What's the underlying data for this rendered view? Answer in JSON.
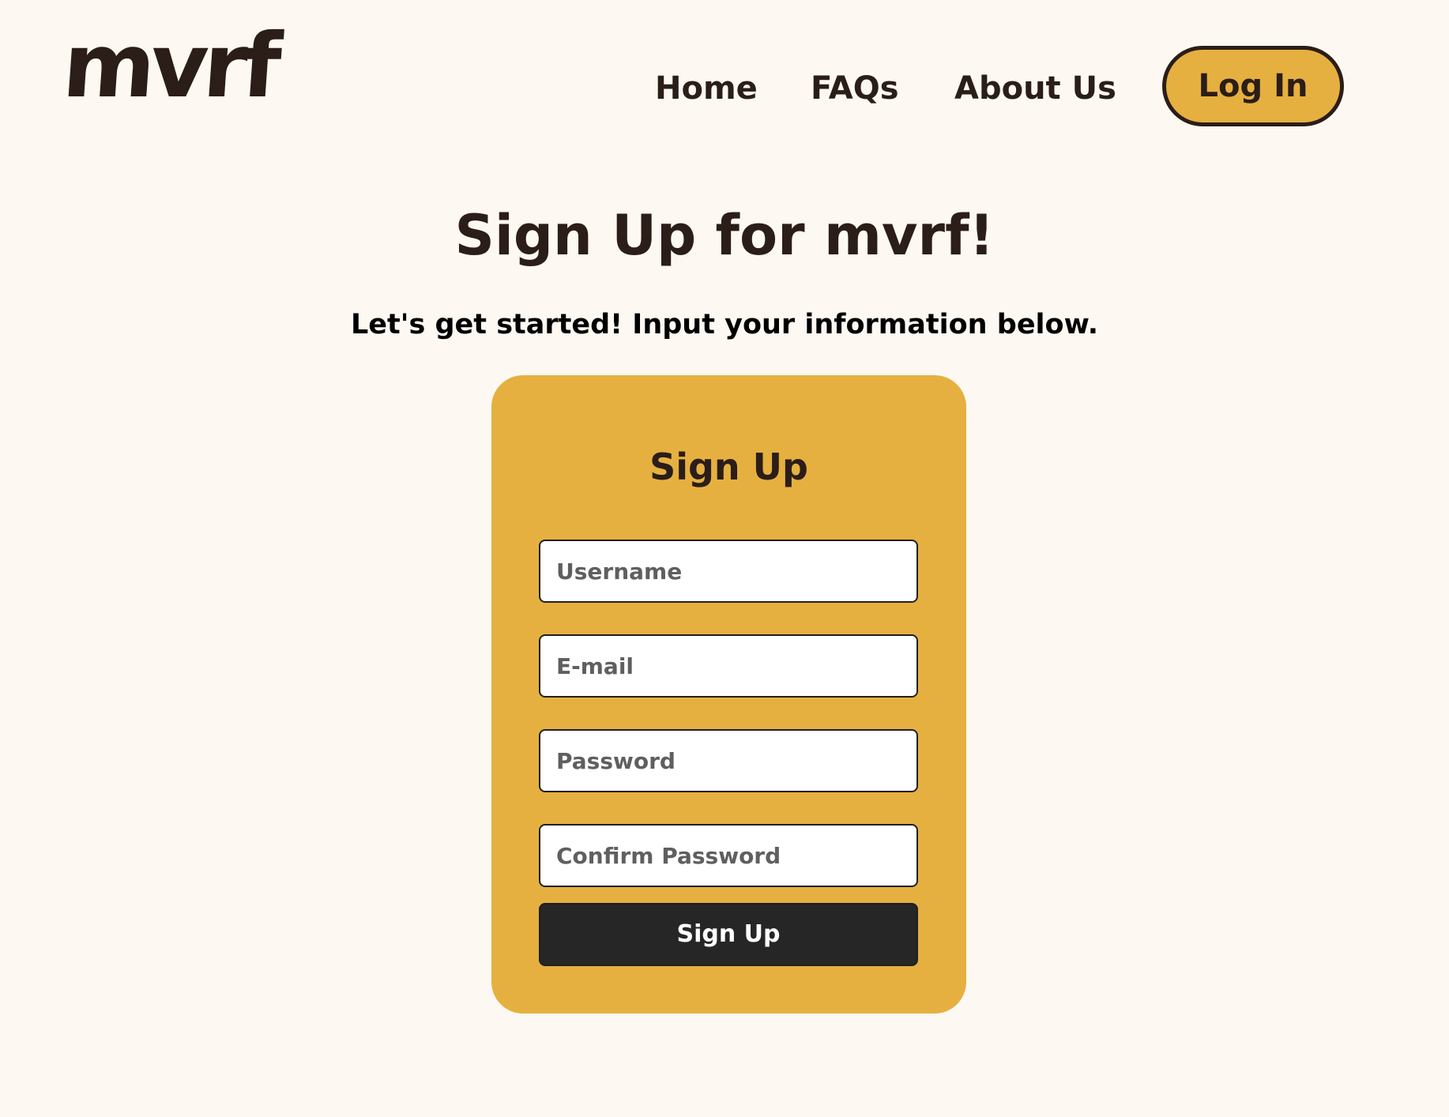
{
  "header": {
    "logo_text": "mvrf",
    "nav": {
      "home": "Home",
      "faqs": "FAQs",
      "about": "About Us"
    },
    "login_label": "Log In"
  },
  "main": {
    "title": "Sign Up for mvrf!",
    "subtitle": "Let's get started! Input your information below."
  },
  "form": {
    "title": "Sign Up",
    "username_placeholder": "Username",
    "email_placeholder": "E-mail",
    "password_placeholder": "Password",
    "confirm_password_placeholder": "Confirm Password",
    "submit_label": "Sign Up"
  },
  "colors": {
    "background": "#fdf9f2",
    "accent": "#e6b040",
    "text": "#2b1d18",
    "button_dark": "#262626"
  }
}
